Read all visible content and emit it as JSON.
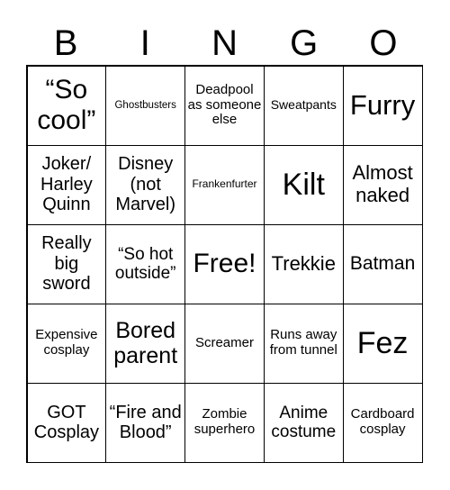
{
  "header": [
    "B",
    "I",
    "N",
    "G",
    "O"
  ],
  "cells": [
    {
      "text": "“So cool”",
      "size": 30
    },
    {
      "text": "Ghostbusters",
      "size": 11.5
    },
    {
      "text": "Deadpool as someone else",
      "size": 15
    },
    {
      "text": "Sweatpants",
      "size": 14
    },
    {
      "text": "Furry",
      "size": 31
    },
    {
      "text": "Joker/ Harley Quinn",
      "size": 20
    },
    {
      "text": "Disney (not Marvel)",
      "size": 20
    },
    {
      "text": "Frankenfurter",
      "size": 12
    },
    {
      "text": "Kilt",
      "size": 34
    },
    {
      "text": "Almost naked",
      "size": 22
    },
    {
      "text": "Really big sword",
      "size": 20
    },
    {
      "text": "“So hot outside”",
      "size": 19
    },
    {
      "text": "Free!",
      "size": 30
    },
    {
      "text": "Trekkie",
      "size": 22
    },
    {
      "text": "Batman",
      "size": 21
    },
    {
      "text": "Expensive cosplay",
      "size": 15
    },
    {
      "text": "Bored parent",
      "size": 25
    },
    {
      "text": "Screamer",
      "size": 15
    },
    {
      "text": "Runs away from tunnel",
      "size": 15
    },
    {
      "text": "Fez",
      "size": 34
    },
    {
      "text": "GOT Cosplay",
      "size": 20
    },
    {
      "text": "“Fire and Blood”",
      "size": 20
    },
    {
      "text": "Zombie superhero",
      "size": 15
    },
    {
      "text": "Anime costume",
      "size": 19
    },
    {
      "text": "Cardboard cosplay",
      "size": 15
    }
  ]
}
